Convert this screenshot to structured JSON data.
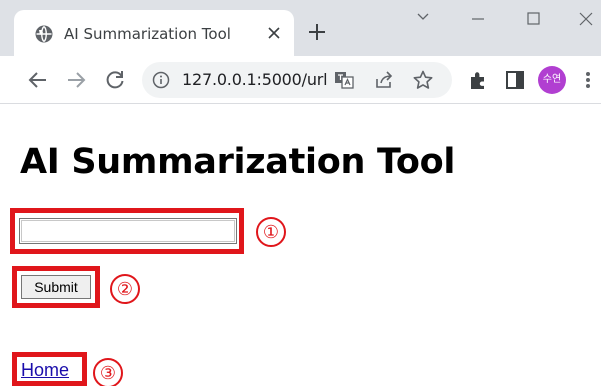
{
  "tab": {
    "title": "AI Summarization Tool"
  },
  "omnibox": {
    "url": "127.0.0.1:5000/url"
  },
  "profile": {
    "initials": "수연",
    "color": "#b13fd1"
  },
  "page": {
    "title": "AI Summarization Tool",
    "input_value": "",
    "submit_label": "Submit",
    "home_link": "Home"
  },
  "annotations": {
    "markers": [
      "①",
      "②",
      "③"
    ],
    "color": "#e0161b"
  },
  "icons": [
    "globe-icon",
    "close-icon",
    "plus-icon",
    "chevron-down-icon",
    "minimize-icon",
    "maximize-icon",
    "window-close-icon",
    "back-icon",
    "forward-icon",
    "reload-icon",
    "info-icon",
    "translate-icon",
    "share-icon",
    "star-icon",
    "extensions-icon",
    "side-panel-icon",
    "menu-icon"
  ]
}
